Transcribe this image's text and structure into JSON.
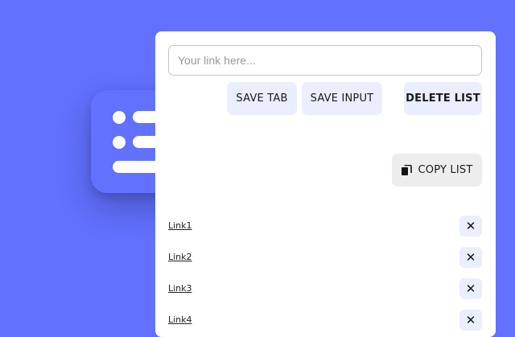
{
  "colors": {
    "background": "#6271ff",
    "icon_tile": "#6271ff",
    "panel": "#ffffff",
    "button_bg": "#eaeeff",
    "copy_button_bg": "#ededed"
  },
  "app_icon": {
    "icon": "list-icon"
  },
  "input": {
    "placeholder": "Your link here...",
    "value": ""
  },
  "buttons": {
    "save_tab": "SAVE TAB",
    "save_input": "SAVE INPUT",
    "delete_list": "DELETE LIST",
    "copy_list": "COPY LIST",
    "copy_icon": "copy-icon"
  },
  "links": [
    {
      "label": "Link1",
      "remove": "✕"
    },
    {
      "label": "Link2",
      "remove": "✕"
    },
    {
      "label": "Link3",
      "remove": "✕"
    },
    {
      "label": "Link4",
      "remove": "✕"
    }
  ]
}
